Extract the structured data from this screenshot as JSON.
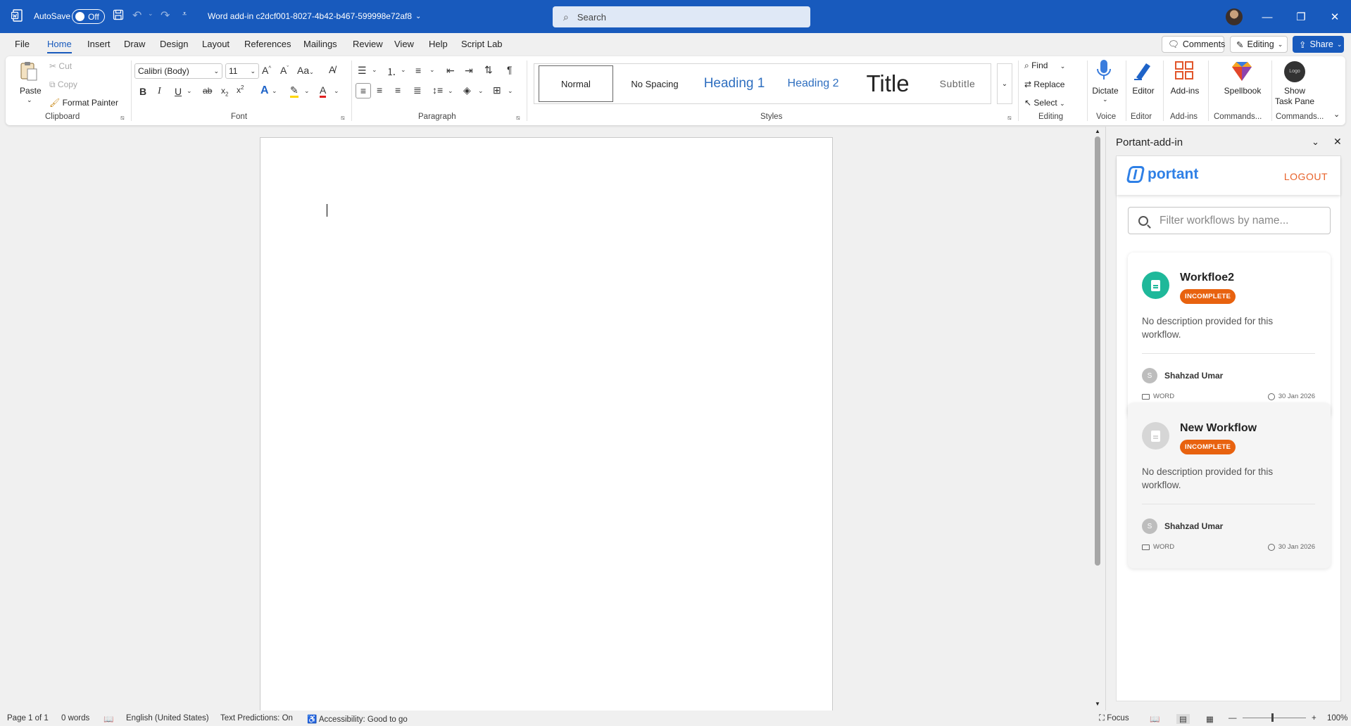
{
  "titlebar": {
    "autosave_label": "AutoSave",
    "autosave_state": "Off",
    "doc_title": "Word add-in c2dcf001-8027-4b42-b467-599998e72af8",
    "search_placeholder": "Search",
    "accent": "#185abd"
  },
  "menu": {
    "items": [
      "File",
      "Home",
      "Insert",
      "Draw",
      "Design",
      "Layout",
      "References",
      "Mailings",
      "Review",
      "View",
      "Help",
      "Script Lab"
    ],
    "active": "Home",
    "comments_label": "Comments",
    "editing_label": "Editing",
    "share_label": "Share"
  },
  "ribbon": {
    "clipboard": {
      "paste": "Paste",
      "cut": "Cut",
      "copy": "Copy",
      "format_painter": "Format Painter",
      "label": "Clipboard"
    },
    "font": {
      "family": "Calibri (Body)",
      "size": "11",
      "label": "Font"
    },
    "paragraph": {
      "label": "Paragraph"
    },
    "styles": {
      "items": [
        "Normal",
        "No Spacing",
        "Heading 1",
        "Heading 2",
        "Title",
        "Subtitle"
      ],
      "label": "Styles"
    },
    "editing": {
      "find": "Find",
      "replace": "Replace",
      "select": "Select",
      "label": "Editing"
    },
    "voice": {
      "dictate": "Dictate",
      "label": "Voice"
    },
    "editor": {
      "button": "Editor",
      "label": "Editor"
    },
    "addins": {
      "button": "Add-ins",
      "label": "Add-ins"
    },
    "commands1": {
      "button": "Spellbook",
      "label": "Commands..."
    },
    "commands2": {
      "button_line1": "Show",
      "button_line2": "Task Pane",
      "logo_text": "Logo",
      "label": "Commands..."
    }
  },
  "taskpane": {
    "title": "Portant-add-in",
    "brand": "portant",
    "logout": "LOGOUT",
    "filter_placeholder": "Filter workflows by name...",
    "workflows": [
      {
        "name": "Workfloe2",
        "status": "INCOMPLETE",
        "description": "No description provided for this workflow.",
        "author_initial": "S",
        "author": "Shahzad Umar",
        "type": "WORD",
        "date": "30 Jan 2026",
        "icon_color": "#1fb89a"
      },
      {
        "name": "New Workflow",
        "status": "INCOMPLETE",
        "description": "No description provided for this workflow.",
        "author_initial": "S",
        "author": "Shahzad Umar",
        "type": "WORD",
        "date": "30 Jan 2026",
        "icon_color": "#c9c9c9"
      }
    ]
  },
  "statusbar": {
    "page": "Page 1 of 1",
    "words": "0 words",
    "language": "English (United States)",
    "predictions": "Text Predictions: On",
    "accessibility": "Accessibility: Good to go",
    "focus": "Focus",
    "zoom": "100%"
  }
}
